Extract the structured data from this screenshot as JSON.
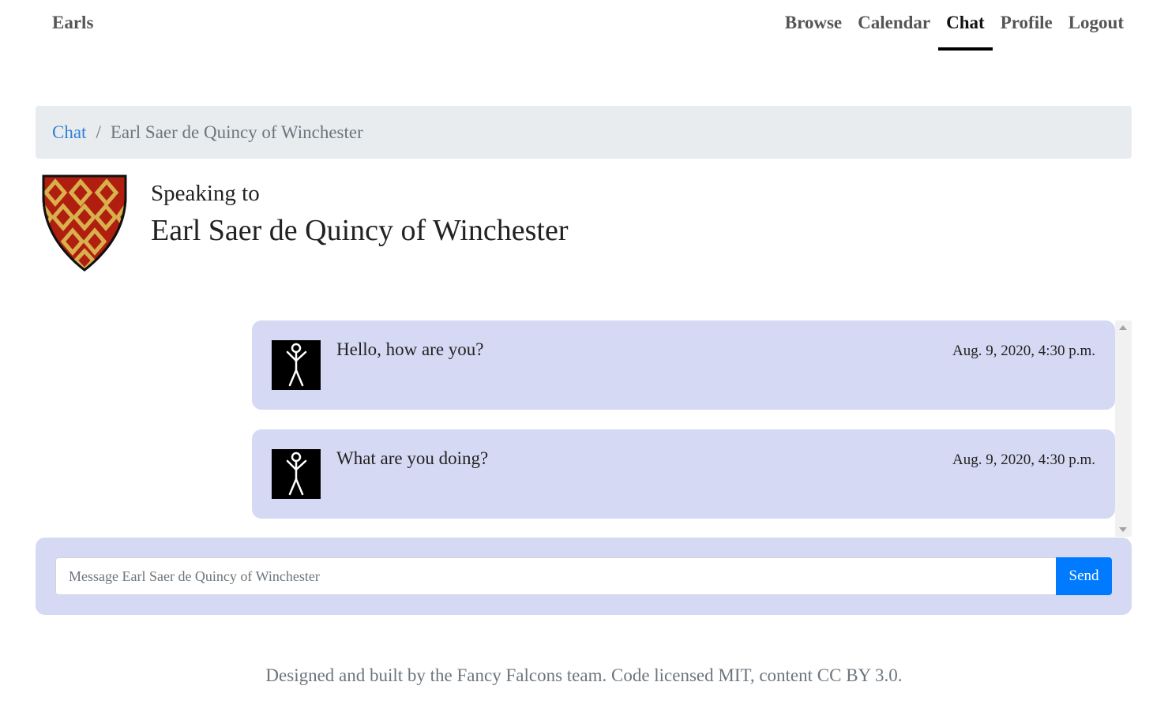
{
  "navbar": {
    "brand": "Earls",
    "items": [
      {
        "label": "Browse"
      },
      {
        "label": "Calendar"
      },
      {
        "label": "Chat"
      },
      {
        "label": "Profile"
      },
      {
        "label": "Logout"
      }
    ],
    "active": "Chat"
  },
  "breadcrumb": {
    "link": "Chat",
    "separator": "/",
    "current": "Earl Saer de Quincy of Winchester"
  },
  "header": {
    "label": "Speaking to",
    "name": "Earl Saer de Quincy of Winchester",
    "shield_icon": "coat-of-arms-icon"
  },
  "messages": [
    {
      "text": "Hello, how are you?",
      "time": "Aug. 9, 2020, 4:30 p.m.",
      "avatar_icon": "stick-figure-icon"
    },
    {
      "text": "What are you doing?",
      "time": "Aug. 9, 2020, 4:30 p.m.",
      "avatar_icon": "stick-figure-icon"
    }
  ],
  "composer": {
    "placeholder": "Message Earl Saer de Quincy of Winchester",
    "value": "",
    "send_label": "Send"
  },
  "footer": {
    "text": "Designed and built by the Fancy Falcons team. Code licensed MIT, content CC BY 3.0."
  },
  "colors": {
    "message_bg": "#d6d9f3",
    "breadcrumb_bg": "#e9ecef",
    "accent": "#007bff",
    "shield_red": "#b01e10",
    "shield_gold": "#d8b04c"
  }
}
